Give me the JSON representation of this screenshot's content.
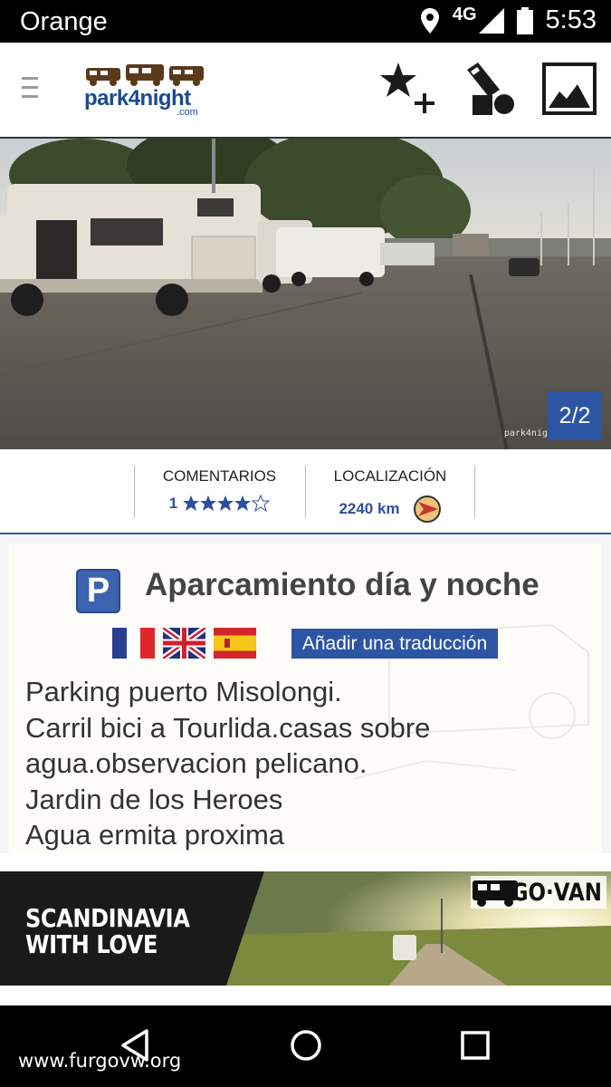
{
  "status_bar": {
    "carrier": "Orange",
    "network": "4G",
    "time": "5:53",
    "icons": [
      "location-pin-icon",
      "signal-icon",
      "battery-icon"
    ]
  },
  "header": {
    "logo_text": "park4night",
    "logo_suffix": ".com",
    "actions": [
      "add-favorite-icon",
      "tools-icon",
      "photo-icon"
    ]
  },
  "photo": {
    "counter": "2/2",
    "watermark": "park4nig"
  },
  "stats": {
    "comments_label": "COMENTARIOS",
    "comments_count": "1",
    "rating_stars": 4,
    "rating_max": 5,
    "location_label": "LOCALIZACIÓN",
    "distance": "2240 km"
  },
  "spot": {
    "type_badge": "P",
    "title": "Aparcamiento día y noche",
    "flags": [
      "flag-france",
      "flag-uk",
      "flag-spain"
    ],
    "translate_label": "Añadir una traducción",
    "description_lines": [
      "Parking puerto Misolongi.",
      "Carril bici a Tourlida.casas sobre",
      "agua.observacion pelicano.",
      "Jardin de los Heroes",
      "Agua ermita proxima"
    ]
  },
  "ad": {
    "text_line1": "SCANDINAVIA",
    "text_line2": "WITH LOVE",
    "brand": "GO·VAN"
  },
  "nav": {
    "buttons": [
      "back-icon",
      "home-icon",
      "recent-apps-icon"
    ],
    "site_watermark": "www.furgovw.org"
  },
  "colors": {
    "brand_blue": "#2c55a4",
    "status_bar": "#000000",
    "text_dark": "#444444"
  }
}
